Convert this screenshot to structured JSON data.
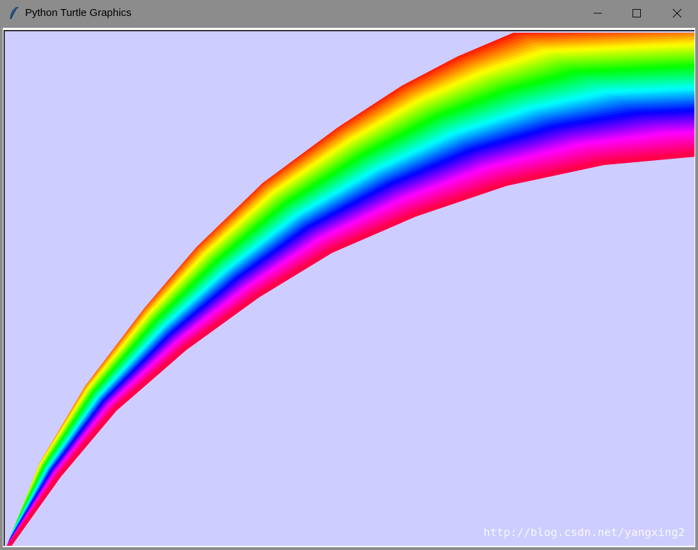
{
  "window": {
    "title": "Python Turtle Graphics",
    "icon": "feather-icon"
  },
  "controls": {
    "minimize": "minimize-icon",
    "maximize": "maximize-icon",
    "close": "close-icon"
  },
  "canvas": {
    "background": "#cdcdff",
    "watermark": "http://blog.csdn.net/yangxing2",
    "rainbow_colors": [
      "#ff0000",
      "#ffff00",
      "#00ff00",
      "#00ffff",
      "#0000ff",
      "#ff00ff",
      "#ff0040"
    ]
  }
}
